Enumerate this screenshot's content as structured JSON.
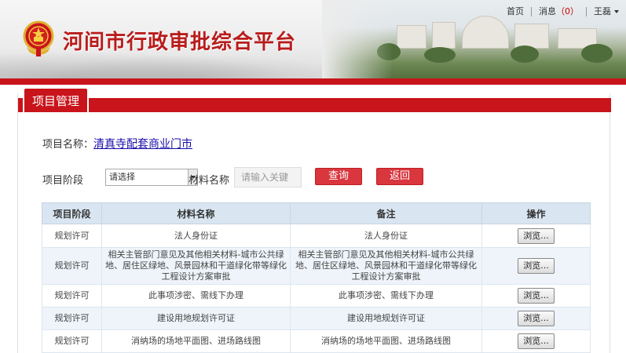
{
  "header": {
    "site_title": "河间市行政审批综合平台",
    "nav": {
      "home": "首页",
      "messages": "消息",
      "messages_count_open": "（",
      "messages_count": "0",
      "messages_count_close": "）",
      "user": "王磊"
    }
  },
  "panel": {
    "tab_label": "项目管理",
    "project_name_label": "项目名称：",
    "project_name_value": "清真寺配套商业门市"
  },
  "filter": {
    "stage_label": "项目阶段",
    "stage_selected": "请选择",
    "material_label": "材料名称",
    "material_placeholder": "请输入关键",
    "query_label": "查询",
    "back_label": "返回"
  },
  "table": {
    "headers": [
      "项目阶段",
      "材料名称",
      "备注",
      "操作"
    ],
    "rows": [
      {
        "stage": "规划许可",
        "material": "法人身份证",
        "note": "法人身份证",
        "action": "浏览..."
      },
      {
        "stage": "规划许可",
        "material": "相关主管部门意见及其他相关材料-城市公共绿地、居住区绿地、风景园林和干道绿化带等绿化工程设计方案审批",
        "note": "相关主管部门意见及其他相关材料-城市公共绿地、居住区绿地、风景园林和干道绿化带等绿化工程设计方案审批",
        "action": "浏览..."
      },
      {
        "stage": "规划许可",
        "material": "此事项涉密、需线下办理",
        "note": "此事项涉密、需线下办理",
        "action": "浏览..."
      },
      {
        "stage": "规划许可",
        "material": "建设用地规划许可证",
        "note": "建设用地规划许可证",
        "action": "浏览..."
      },
      {
        "stage": "规划许可",
        "material": "消纳场的场地平面图、进场路线图",
        "note": "消纳场的场地平面图、进场路线图",
        "action": "浏览..."
      }
    ]
  },
  "colors": {
    "brand_red": "#c8141a",
    "button_red": "#d9363e",
    "header_row": "#d9e6f2",
    "link": "#1a0dab"
  }
}
